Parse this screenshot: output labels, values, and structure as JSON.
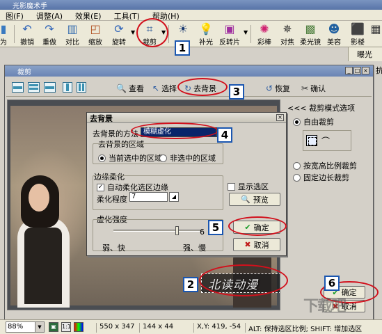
{
  "app": {
    "title": "光影魔术手",
    "menu": [
      "图(F)",
      "调整(A)",
      "效果(E)",
      "工具(T)",
      "帮助(H)"
    ],
    "toolbar": [
      {
        "label": "为",
        "icon": "partial-icon"
      },
      {
        "label": "撤销",
        "icon": "undo-icon"
      },
      {
        "label": "重做",
        "icon": "redo-icon"
      },
      {
        "label": "对比",
        "icon": "compare-icon"
      },
      {
        "label": "缩放",
        "icon": "resize-icon"
      },
      {
        "label": "旋转",
        "icon": "rotate-icon"
      },
      {
        "label": "裁剪",
        "icon": "crop-icon"
      },
      {
        "label": "",
        "icon": "brightness-icon"
      },
      {
        "label": "补光",
        "icon": "fill-light-icon"
      },
      {
        "label": "反转片",
        "icon": "reversal-film-icon"
      },
      {
        "label": "彩棒",
        "icon": "color-wand-icon"
      },
      {
        "label": "对焦",
        "icon": "focus-icon"
      },
      {
        "label": "柔光镜",
        "icon": "soft-lens-icon"
      },
      {
        "label": "美容",
        "icon": "beauty-icon"
      },
      {
        "label": "影楼",
        "icon": "studio-icon"
      },
      {
        "label": "",
        "icon": "more-icon"
      }
    ],
    "right_tab": "曝光",
    "right_tab_prefix": "抗"
  },
  "crop_dialog": {
    "title": "裁剪",
    "toolbar": {
      "view_label": "查看",
      "select_label": "选择",
      "remove_bg_label": "去背景",
      "restore_label": "恢复",
      "confirm_label": "确认"
    },
    "right_pane": {
      "title": "<<< 裁剪模式选项",
      "free_crop": "自由裁剪",
      "ratio_crop": "按宽高比例裁剪",
      "fixed_crop": "固定边长裁剪"
    },
    "ok_label": "确定",
    "cancel_label": "取消",
    "watermark_text": "北读动漫"
  },
  "statusbar": {
    "zoom": "88%",
    "one_to_one": "1:1",
    "image_size": "550 x 347",
    "selection_size": "144 x 44",
    "cursor_pos": "X,Y: 419, -54",
    "hint": "ALT: 保持选区比例; SHIFT: 增加选区"
  },
  "remove_bg_dialog": {
    "title": "去背景",
    "method_label": "去背景的方法",
    "method_value": "模糊虚化",
    "region_label": "去背景的区域",
    "region_current": "当前选中的区域",
    "region_unselected": "非选中的区域",
    "edge_label": "边缘柔化",
    "auto_soften_label": "自动柔化选区边缘",
    "soften_level_label": "柔化程度",
    "soften_level_value": "7",
    "show_selection_label": "显示选区",
    "preview_label": "预览",
    "blur_label": "虚化强度",
    "blur_value": 0.72,
    "blur_number": "6",
    "blur_weak": "弱、快",
    "blur_strong": "强、慢",
    "ok_label": "确定",
    "cancel_label": "取消"
  },
  "annotations": [
    "1",
    "2",
    "3",
    "4",
    "5",
    "6"
  ],
  "site_logo": "下载吧"
}
